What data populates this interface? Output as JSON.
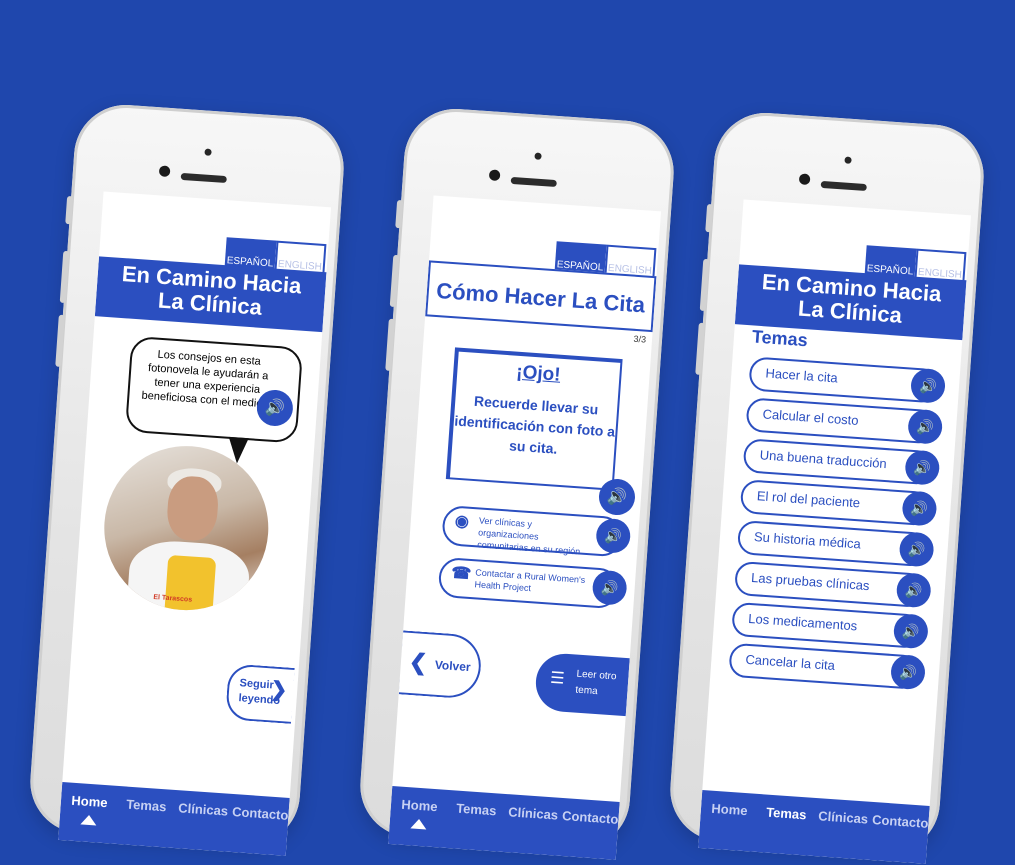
{
  "colors": {
    "background": "#1f47ad",
    "accent": "#2b4fc0"
  },
  "phones": [
    {
      "lang": {
        "es": "ESPAÑOL",
        "en": "ENGLISH"
      },
      "title_l1": "En Camino Hacia",
      "title_l2": "La Clínica",
      "bubble_text": "Los consejos en esta fotonovela le ayudarán a tener una experiencia beneficiosa con el medico.",
      "photo_label": "El Tarascos",
      "next_label_1": "Seguir",
      "next_label_2": "leyendo",
      "nav": [
        "Home",
        "Temas",
        "Clínicas",
        "Contacto"
      ]
    },
    {
      "lang": {
        "es": "ESPAÑOL",
        "en": "ENGLISH"
      },
      "title": "Cómo Hacer La Cita",
      "page_count": "3/3",
      "ojo_heading": "¡Ojo!",
      "ojo_body": "Recuerde llevar su identificación con foto a su cita.",
      "links": [
        {
          "icon": "map-pin-icon",
          "text": "Ver clínicas y organizaciones comunitarias en su región"
        },
        {
          "icon": "phone-icon",
          "text": "Contactar a Rural Women's Health Project"
        }
      ],
      "back_label": "Volver",
      "read_other_l1": "Leer otro",
      "read_other_l2": "tema",
      "nav": [
        "Home",
        "Temas",
        "Clínicas",
        "Contacto"
      ]
    },
    {
      "lang": {
        "es": "ESPAÑOL",
        "en": "ENGLISH"
      },
      "title_l1": "En Camino Hacia",
      "title_l2": "La Clínica",
      "section_heading": "Temas",
      "topics": [
        "Hacer la cita",
        "Calcular el costo",
        "Una buena traducción",
        "El rol del paciente",
        "Su historia médica",
        "Las pruebas clínicas",
        "Los medicamentos",
        "Cancelar la cita"
      ],
      "nav": [
        "Home",
        "Temas",
        "Clínicas",
        "Contacto"
      ]
    }
  ]
}
